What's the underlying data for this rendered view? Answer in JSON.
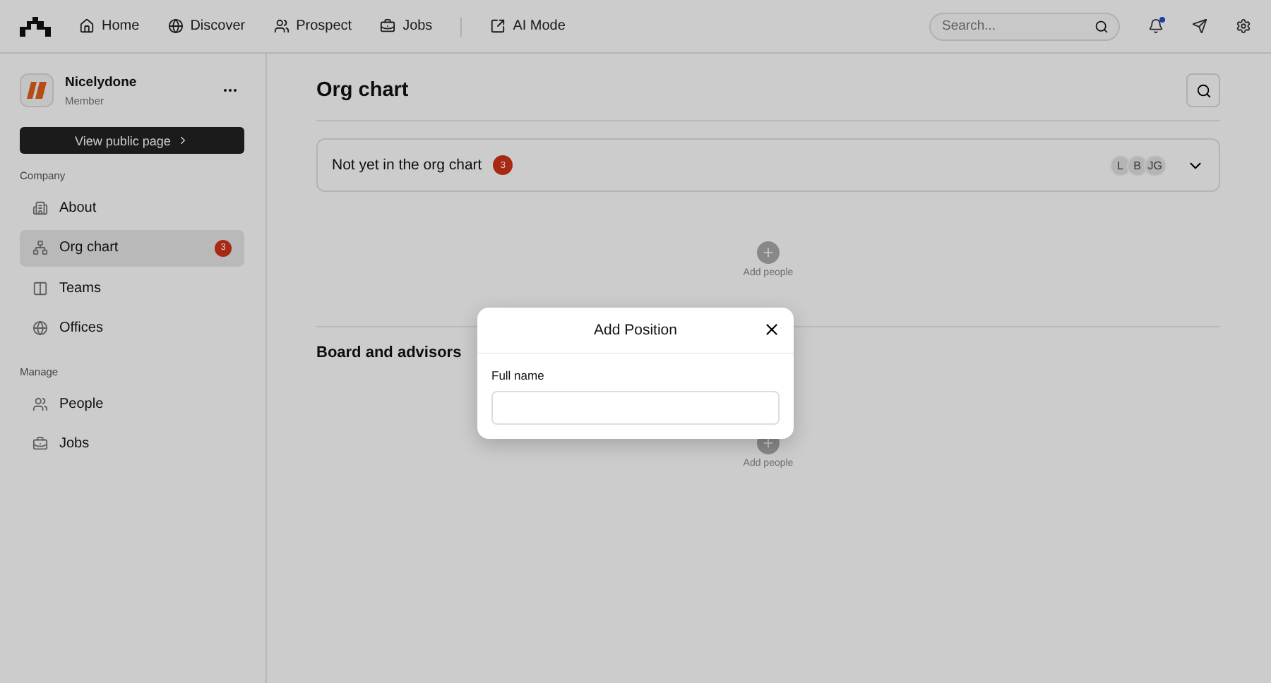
{
  "nav": {
    "items": [
      {
        "label": "Home"
      },
      {
        "label": "Discover"
      },
      {
        "label": "Prospect"
      },
      {
        "label": "Jobs"
      },
      {
        "label": "AI Mode"
      }
    ],
    "search": {
      "placeholder": "Search..."
    },
    "notifications": {
      "unread": true
    }
  },
  "sidebar": {
    "company": {
      "name": "Nicelydone",
      "role": "Member"
    },
    "public_button": "View public page",
    "sections": [
      {
        "title": "Company",
        "items": [
          {
            "label": "About",
            "selected": false
          },
          {
            "label": "Org chart",
            "selected": true,
            "badge": "3"
          },
          {
            "label": "Teams",
            "selected": false
          },
          {
            "label": "Offices",
            "selected": false
          }
        ]
      },
      {
        "title": "Manage",
        "items": [
          {
            "label": "People",
            "selected": false
          },
          {
            "label": "Jobs",
            "selected": false
          }
        ]
      }
    ]
  },
  "main": {
    "title": "Org chart",
    "unassigned": {
      "label": "Not yet in the org chart",
      "badge": "3",
      "avatars": [
        "L",
        "B",
        "JG"
      ],
      "expanded": false,
      "add_label": "Add people"
    },
    "board": {
      "title": "Board and advisors",
      "add_label": "Add people"
    }
  },
  "modal": {
    "title": "Add Position",
    "field_label": "Full name"
  }
}
